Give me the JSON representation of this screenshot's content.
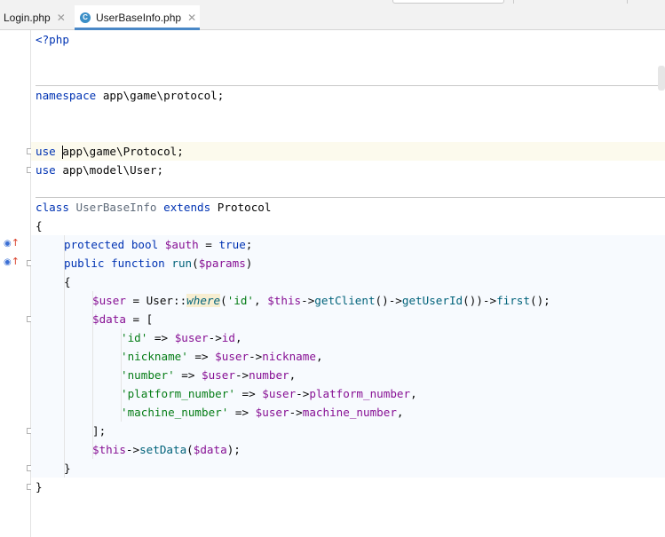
{
  "tabs": [
    {
      "label": "Login.php",
      "active": false
    },
    {
      "label": "UserBaseInfo.php",
      "active": true,
      "icon": "C"
    }
  ],
  "code": {
    "l1": {
      "a": "<?php"
    },
    "l2": {
      "kw": "namespace",
      "rest": " app\\game\\protocol;"
    },
    "l3": {
      "kw": "use",
      "rest": "app\\game\\Protocol;"
    },
    "l4": {
      "kw": "use",
      "rest": " app\\model\\User;"
    },
    "l5": {
      "kw1": "class",
      "name": "UserBaseInfo",
      "kw2": "extends",
      "parent": "Protocol"
    },
    "l6": {
      "a": "{"
    },
    "l7": {
      "kw1": "protected",
      "kw2": "bool",
      "var": "$auth",
      "eq": " = ",
      "val": "true",
      "end": ";"
    },
    "l8": {
      "kw1": "public",
      "kw2": "function",
      "fn": "run",
      "open": "(",
      "var": "$params",
      "close": ")"
    },
    "l9": {
      "a": "{"
    },
    "l10": {
      "var": "$user",
      "p1": " = User::",
      "static": "where",
      "p2": "(",
      "str": "'id'",
      "p3": ", ",
      "this": "$this",
      "p4": "->",
      "fn1": "getClient",
      "p5": "()->",
      "fn2": "getUserId",
      "p6": "())->",
      "fn3": "first",
      "p7": "();"
    },
    "l11": {
      "var": "$data",
      "p1": " = ["
    },
    "l12": {
      "str": "'id'",
      "arrow": " => ",
      "var": "$user",
      "op": "->",
      "prop": "id",
      "end": ","
    },
    "l13": {
      "str": "'nickname'",
      "arrow": " => ",
      "var": "$user",
      "op": "->",
      "prop": "nickname",
      "end": ","
    },
    "l14": {
      "str": "'number'",
      "arrow": " => ",
      "var": "$user",
      "op": "->",
      "prop": "number",
      "end": ","
    },
    "l15": {
      "str": "'platform_number'",
      "arrow": " => ",
      "var": "$user",
      "op": "->",
      "prop": "platform_number",
      "end": ","
    },
    "l16": {
      "str": "'machine_number'",
      "arrow": " => ",
      "var": "$user",
      "op": "->",
      "prop": "machine_number",
      "end": ","
    },
    "l17": {
      "a": "];"
    },
    "l18": {
      "this": "$this",
      "op": "->",
      "fn": "setData",
      "open": "(",
      "var": "$data",
      "close": ");"
    },
    "l19": {
      "a": "}"
    },
    "l20": {
      "a": "}"
    }
  },
  "colors": {
    "keyword": "#0033b3",
    "string": "#067d17",
    "variable": "#871094",
    "function": "#00627a",
    "tab_accent": "#4a88c7"
  }
}
